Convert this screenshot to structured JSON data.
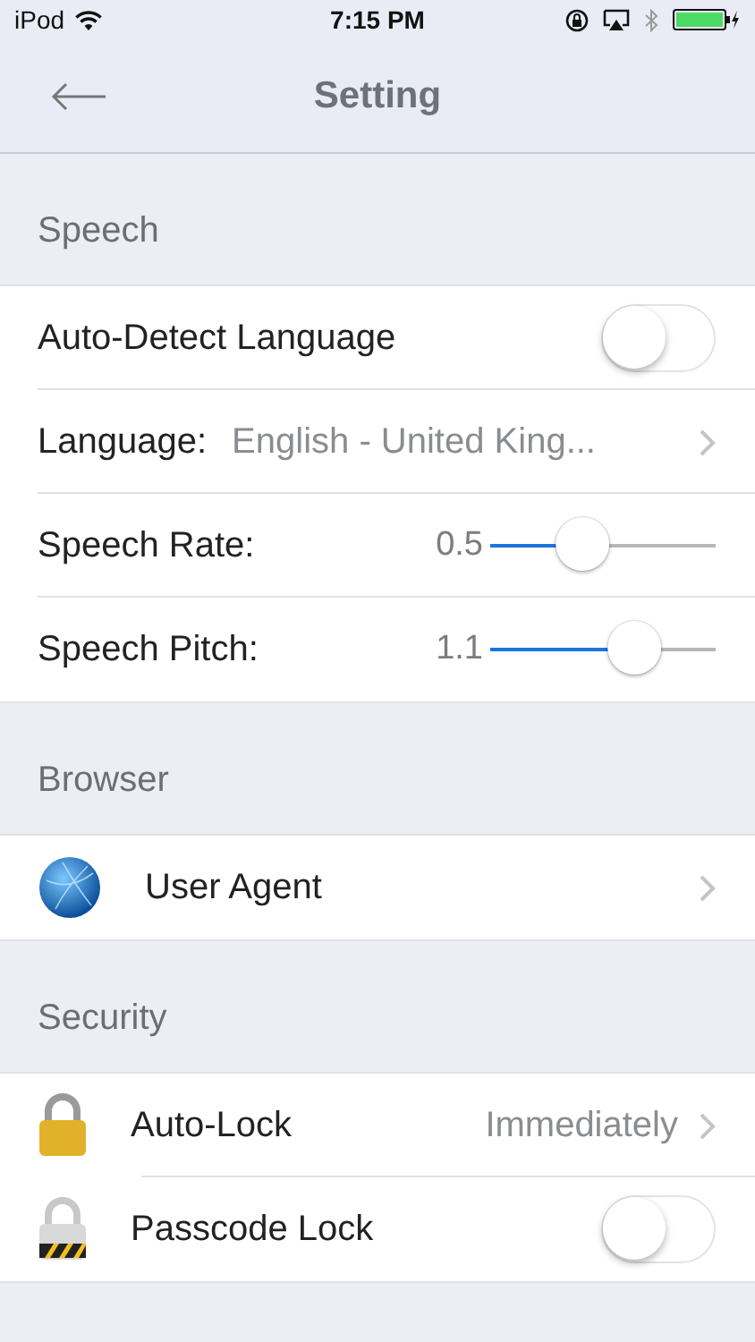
{
  "status_bar": {
    "device": "iPod",
    "time": "7:15 PM"
  },
  "nav": {
    "title": "Setting"
  },
  "sections": [
    {
      "title": "Speech",
      "rows": [
        {
          "kind": "toggle",
          "label": "Auto-Detect Language",
          "on": false
        },
        {
          "kind": "link",
          "label": "Language:",
          "value": "English - United King..."
        },
        {
          "kind": "slider",
          "label": "Speech Rate:",
          "reading": "0.5",
          "level": 0.38
        },
        {
          "kind": "slider",
          "label": "Speech Pitch:",
          "reading": "1.1",
          "level": 0.68
        }
      ]
    },
    {
      "title": "Browser",
      "rows": [
        {
          "kind": "link",
          "label": "User Agent"
        }
      ]
    },
    {
      "title": "Security",
      "rows": [
        {
          "kind": "link",
          "label": "Auto-Lock",
          "value": "Immediately"
        },
        {
          "kind": "toggle",
          "label": "Passcode Lock",
          "on": false
        }
      ]
    }
  ]
}
